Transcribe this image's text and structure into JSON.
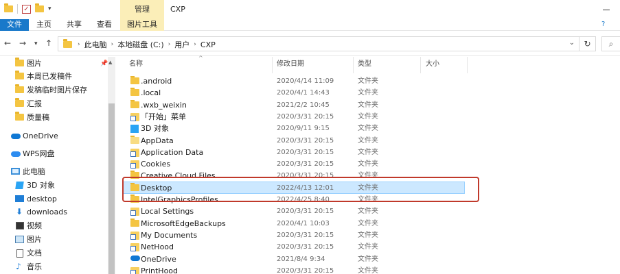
{
  "window": {
    "title": "CXP",
    "context_tab": "管理"
  },
  "ribbon": {
    "tabs": [
      "文件",
      "主页",
      "共享",
      "查看",
      "图片工具"
    ]
  },
  "address": {
    "crumbs": [
      "此电脑",
      "本地磁盘 (C:)",
      "用户",
      "CXP"
    ]
  },
  "nav": {
    "quick_access": [
      "图片",
      "本周已发稿件",
      "发稿临时图片保存",
      "汇报",
      "质量稿"
    ],
    "onedrive": "OneDrive",
    "wps": "WPS网盘",
    "this_pc": "此电脑",
    "pc_items": [
      "3D 对象",
      "desktop",
      "downloads",
      "视频",
      "图片",
      "文档",
      "音乐"
    ]
  },
  "columns": {
    "name": "名称",
    "modified": "修改日期",
    "type": "类型",
    "size": "大小"
  },
  "files": [
    {
      "name": ".android",
      "date": "2020/4/14 11:09",
      "type": "文件夹",
      "icon": "folder"
    },
    {
      "name": ".local",
      "date": "2020/4/1 14:43",
      "type": "文件夹",
      "icon": "folder"
    },
    {
      "name": ".wxb_weixin",
      "date": "2021/2/2 10:45",
      "type": "文件夹",
      "icon": "folder"
    },
    {
      "name": "「开始」菜单",
      "date": "2020/3/31 20:15",
      "type": "文件夹",
      "icon": "shortcut"
    },
    {
      "name": "3D 对象",
      "date": "2020/9/11 9:15",
      "type": "文件夹",
      "icon": "3d"
    },
    {
      "name": "AppData",
      "date": "2020/3/31 20:15",
      "type": "文件夹",
      "icon": "folder-light"
    },
    {
      "name": "Application Data",
      "date": "2020/3/31 20:15",
      "type": "文件夹",
      "icon": "shortcut"
    },
    {
      "name": "Cookies",
      "date": "2020/3/31 20:15",
      "type": "文件夹",
      "icon": "shortcut"
    },
    {
      "name": "Creative Cloud Files",
      "date": "2020/3/31 20:15",
      "type": "文件夹",
      "icon": "folder"
    },
    {
      "name": "Desktop",
      "date": "2022/4/13 12:01",
      "type": "文件夹",
      "icon": "folder"
    },
    {
      "name": "IntelGraphicsProfiles",
      "date": "2022/4/25 8:40",
      "type": "文件夹",
      "icon": "folder"
    },
    {
      "name": "Local Settings",
      "date": "2020/3/31 20:15",
      "type": "文件夹",
      "icon": "shortcut"
    },
    {
      "name": "MicrosoftEdgeBackups",
      "date": "2020/4/1 10:03",
      "type": "文件夹",
      "icon": "folder"
    },
    {
      "name": "My Documents",
      "date": "2020/3/31 20:15",
      "type": "文件夹",
      "icon": "shortcut"
    },
    {
      "name": "NetHood",
      "date": "2020/3/31 20:15",
      "type": "文件夹",
      "icon": "shortcut"
    },
    {
      "name": "OneDrive",
      "date": "2021/8/4 9:34",
      "type": "文件夹",
      "icon": "onedrive"
    },
    {
      "name": "PrintHood",
      "date": "2020/3/31 20:15",
      "type": "文件夹",
      "icon": "shortcut"
    }
  ],
  "selected_file": "Desktop",
  "colors": {
    "accent": "#1979ca",
    "context_tab": "#fbeeb8",
    "selection": "#cce8ff",
    "highlight_box": "#c0392b"
  }
}
